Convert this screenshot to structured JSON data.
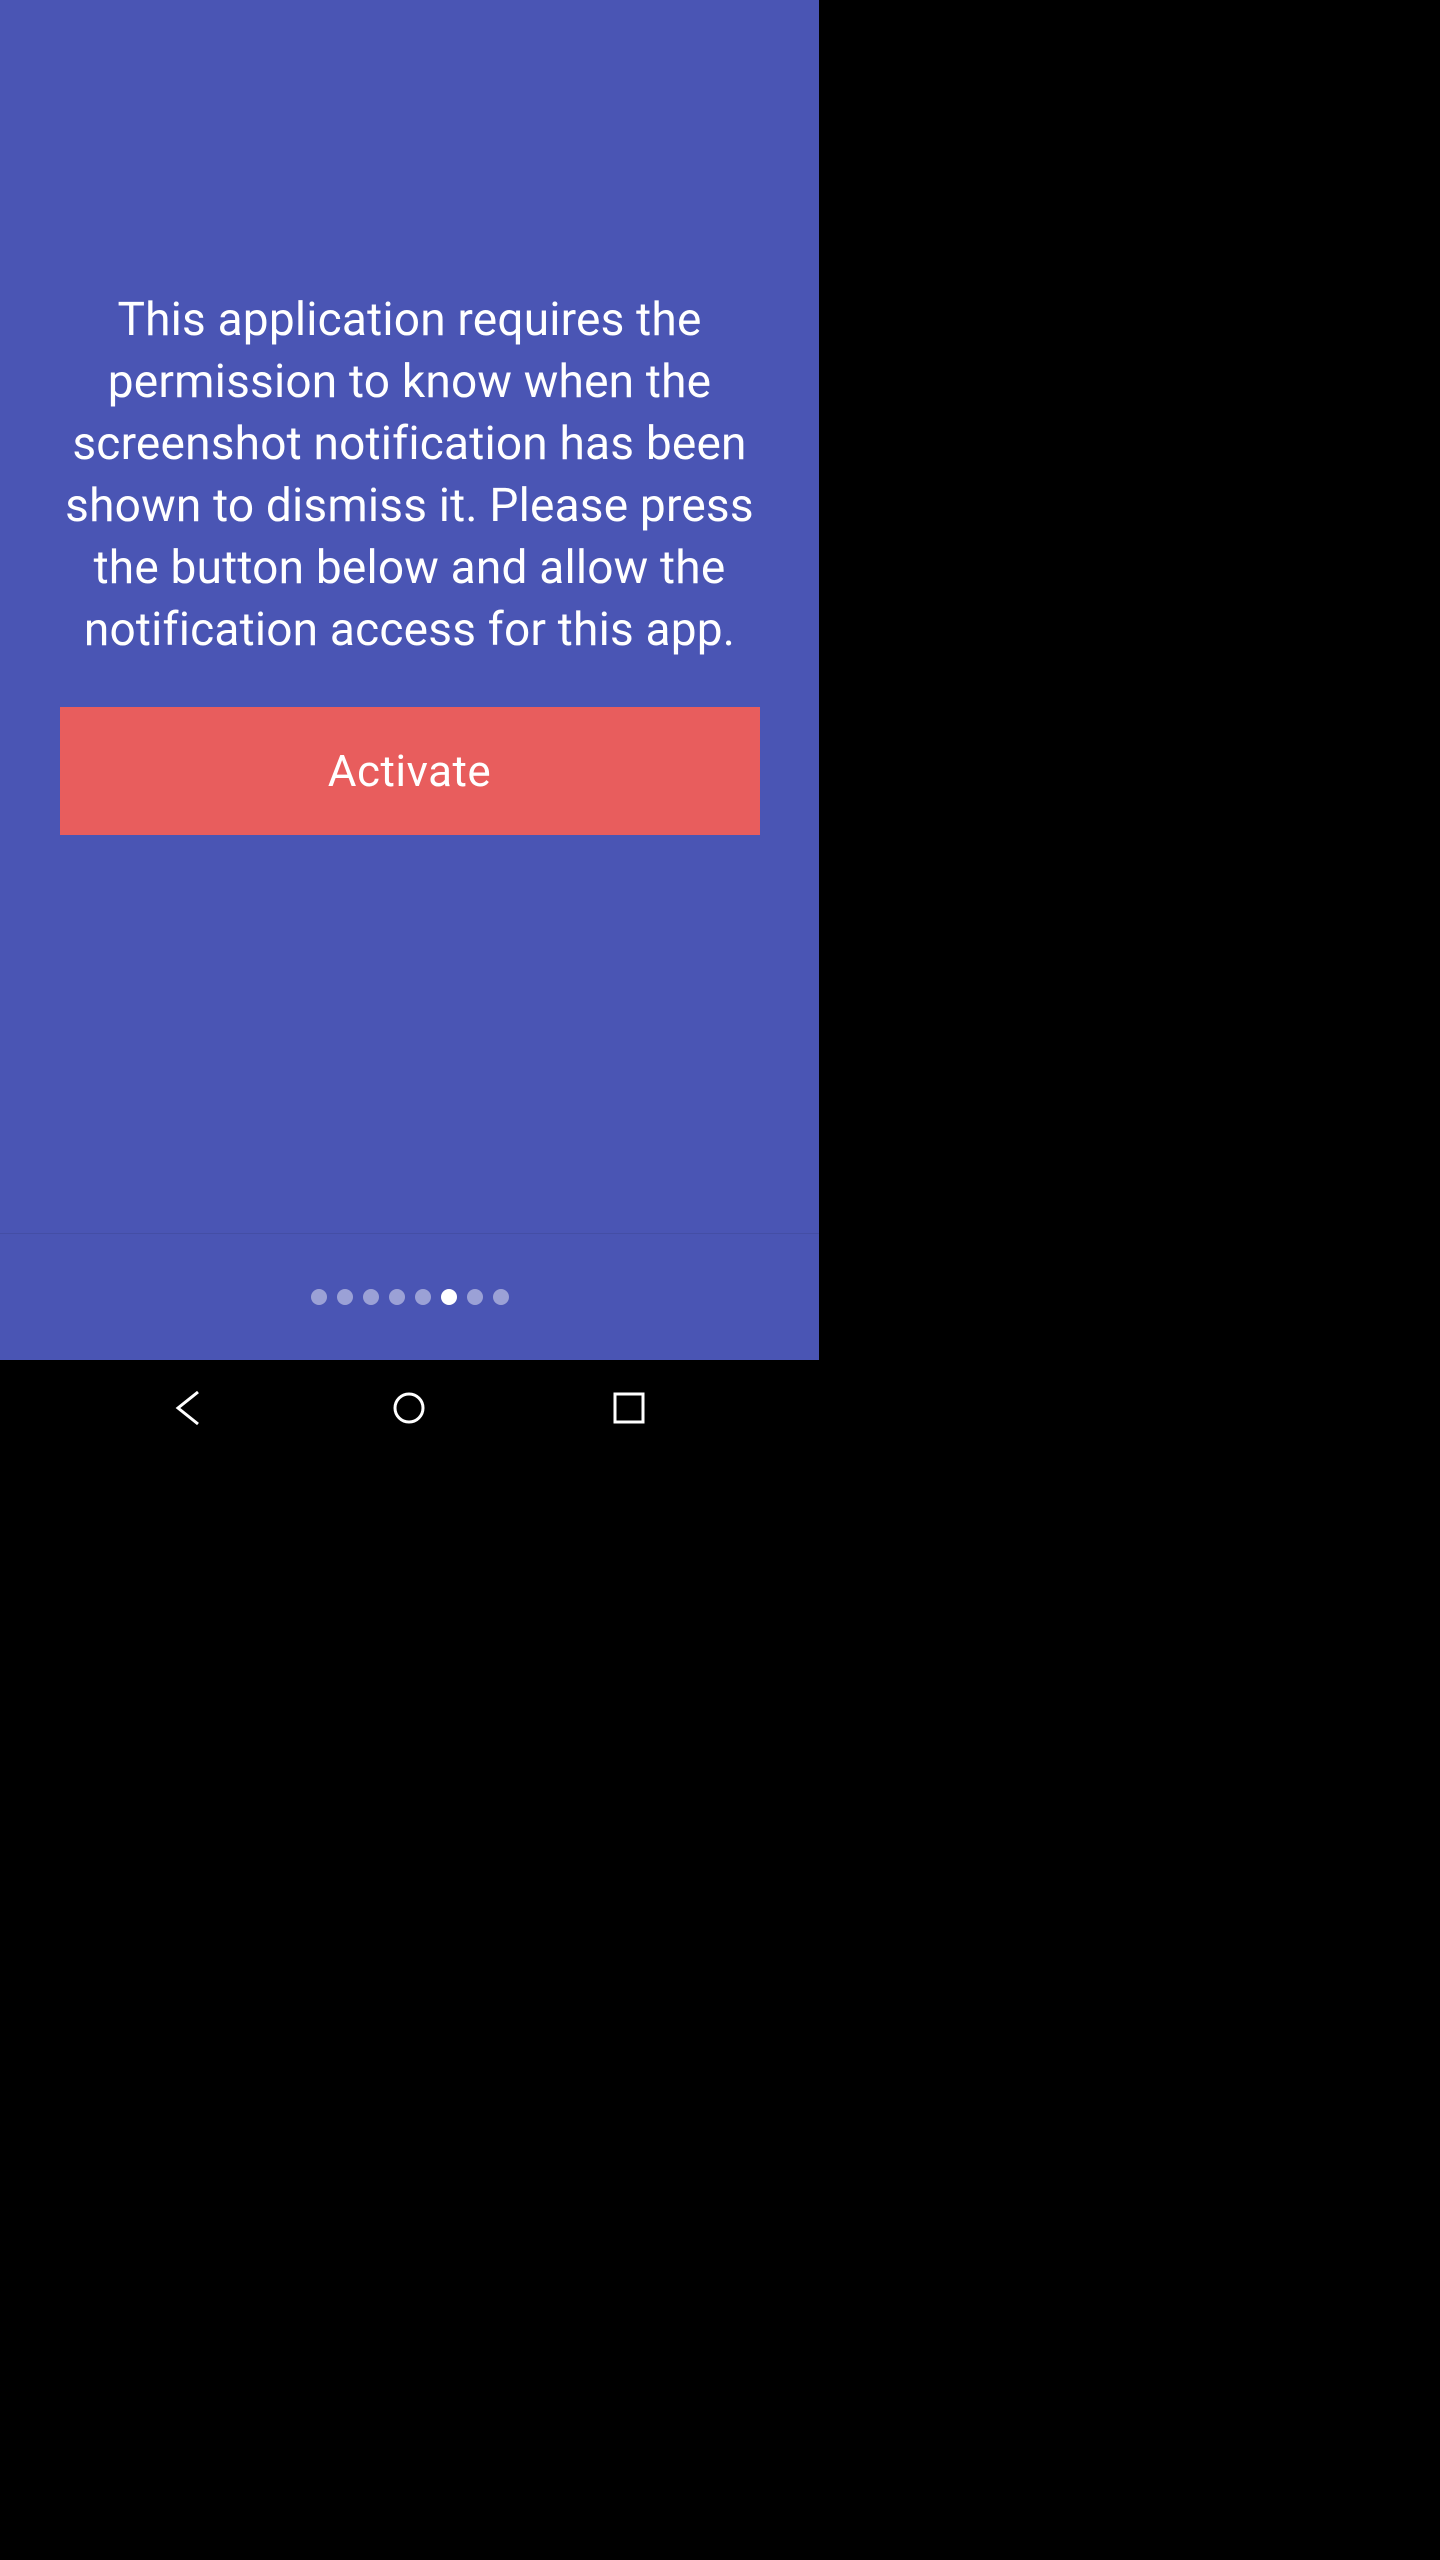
{
  "main": {
    "description": "This application requires the permission to know when the screenshot notification has been shown to dismiss it. Please press the button below and allow the notification access for this app.",
    "activate_label": "Activate"
  },
  "pager": {
    "total": 8,
    "active_index": 5
  },
  "colors": {
    "background": "#4a55b4",
    "button": "#e85d5d",
    "text": "#ffffff"
  }
}
